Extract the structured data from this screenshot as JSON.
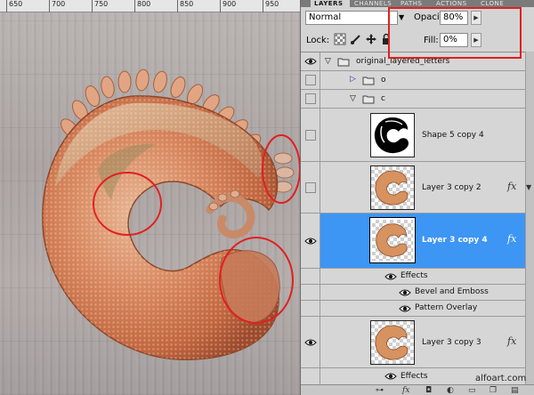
{
  "ruler": {
    "ticks": [
      "650",
      "700",
      "750",
      "800",
      "850",
      "900",
      "950"
    ]
  },
  "tabs": [
    {
      "label": "LAYERS",
      "active": true
    },
    {
      "label": "CHANNELS",
      "active": false
    },
    {
      "label": "PATHS",
      "active": false
    },
    {
      "label": "ACTIONS",
      "active": false
    },
    {
      "label": "CLONE",
      "active": false
    }
  ],
  "options": {
    "blend_mode": "Normal",
    "opacity_label": "Opacity:",
    "opacity_value": "80%",
    "lock_label": "Lock:",
    "fill_label": "Fill:",
    "fill_value": "0%"
  },
  "layers": {
    "group_main": "original_layered_letters",
    "group_o": "o",
    "group_c": "c",
    "shape5": "Shape 5 copy 4",
    "layer3c2": "Layer 3 copy 2",
    "layer3c4": "Layer 3 copy 4",
    "effects_label": "Effects",
    "bevel": "Bevel and Emboss",
    "pattern": "Pattern Overlay",
    "layer3c3": "Layer 3 copy 3",
    "effects_label_2": "Effects",
    "fx_symbol": "fx"
  },
  "watermark": "alfoart.com",
  "colors": {
    "selection": "#3d95f4",
    "annotation": "#e0201f",
    "panel": "#d4d4d4"
  }
}
